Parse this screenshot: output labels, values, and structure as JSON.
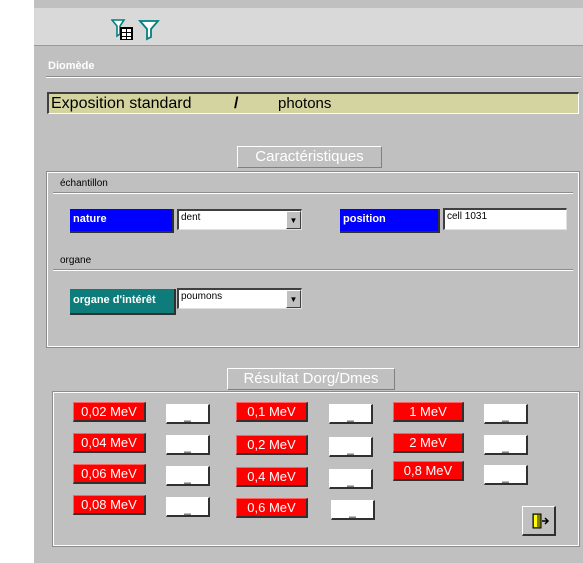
{
  "toolbar": {
    "tools": [
      {
        "icon": "table-filter-icon",
        "color": "#008080"
      },
      {
        "icon": "filter-icon",
        "color": "#008080"
      }
    ]
  },
  "app_title": "Diomède",
  "exposition": {
    "main": "Exposition standard",
    "separator": "/",
    "particle": "photons",
    "background": "#d4d4a0"
  },
  "caracteristiques": {
    "title": "Caractéristiques",
    "echantillon_label": "échantillon",
    "nature": {
      "label": "nature",
      "value": "dent"
    },
    "position": {
      "label": "position",
      "value": "cell 1031"
    },
    "organe_label": "organe",
    "organe": {
      "label": "organe d'intérêt",
      "value": "poumons"
    }
  },
  "resultat": {
    "title": "Résultat Dorg/Dmes",
    "energies": [
      {
        "label": "0,02 MeV",
        "value": "_"
      },
      {
        "label": "0,04 MeV",
        "value": "_"
      },
      {
        "label": "0,06 MeV",
        "value": "_"
      },
      {
        "label": "0,08 MeV",
        "value": "_"
      },
      {
        "label": "0,1 MeV",
        "value": "_"
      },
      {
        "label": "0,2 MeV",
        "value": "_"
      },
      {
        "label": "0,4 MeV",
        "value": "_"
      },
      {
        "label": "0,6 MeV",
        "value": "_"
      },
      {
        "label": "1 MeV",
        "value": "_"
      },
      {
        "label": "2 MeV",
        "value": "_"
      },
      {
        "label": "0,8 MeV",
        "value": "_"
      }
    ]
  },
  "colors": {
    "label_blue": "#0000ff",
    "label_teal": "#0e7c7b",
    "energy_red": "#ff0000",
    "window_gray": "#c0c0c0"
  },
  "exit_button": {
    "icon": "exit-door-icon"
  }
}
